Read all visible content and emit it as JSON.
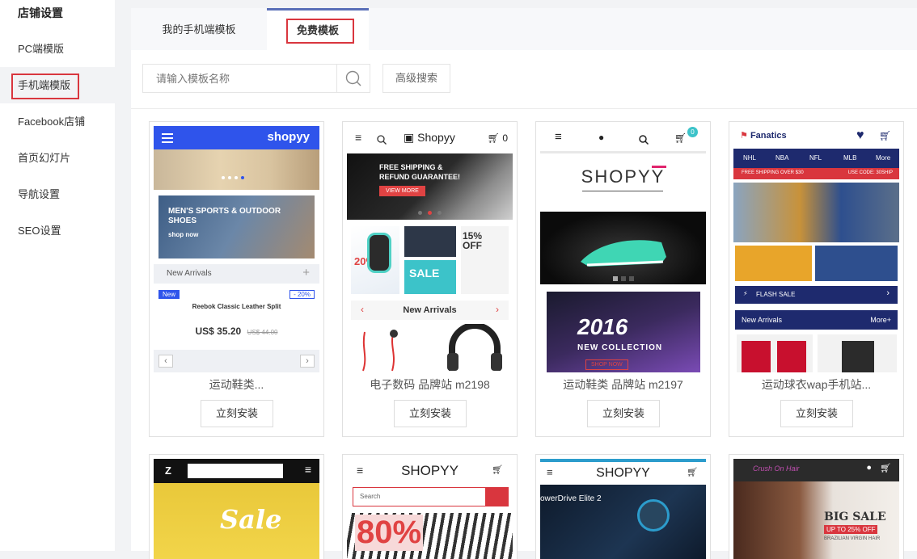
{
  "sidebar": {
    "title": "店铺设置",
    "items": [
      "PC端模版",
      "手机端模版",
      "Facebook店铺",
      "首页幻灯片",
      "导航设置",
      "SEO设置"
    ]
  },
  "tabs": [
    "我的手机端模板",
    "免费模板"
  ],
  "search": {
    "placeholder": "请输入模板名称",
    "advanced_label": "高级搜索"
  },
  "install_label": "立刻安装",
  "templates": [
    {
      "name": "运动鞋类...",
      "brand": "shopyy",
      "banner_text": "MEN'S SPORTS & OUTDOOR SHOES",
      "banner_link": "shop now",
      "section": "New Arrivals",
      "badge_new": "New",
      "badge_discount": "- 20%",
      "product": "Reebok Classic Leather Split",
      "price": "US$ 35.20",
      "old_price": "US$ 44.00"
    },
    {
      "name": "电子数码 品牌站 m2198",
      "brand": "Shopyy",
      "cart_count": "0",
      "hero_line1": "FREE SHIPPING &",
      "hero_line2": "REFUND GUARANTEE!",
      "hero_btn": "VIEW MORE",
      "promo1": "20%",
      "promo2": "SALE",
      "promo3": "15% OFF",
      "section": "New Arrivals"
    },
    {
      "name": "运动鞋类 品牌站 m2197",
      "brand": "SHOPYY",
      "cart_count": "0",
      "hero_year": "2016",
      "hero_sub": "NEW COLLECTION",
      "hero_btn": "SHOP NOW"
    },
    {
      "name": "运动球衣wap手机站...",
      "brand": "Fanatics",
      "nav": [
        "NHL",
        "NBA",
        "NFL",
        "MLB",
        "More"
      ],
      "promo_left": "FREE SHIPPING OVER $30",
      "promo_right": "USE CODE: 30SHIP",
      "flash": "FLASH SALE",
      "section": "New Arrivals",
      "more": "More+"
    }
  ],
  "templates_row2": [
    {
      "logo": "Z",
      "sale": "Sale"
    },
    {
      "brand": "SHOPYY",
      "search_placeholder": "Search",
      "promo": "80%"
    },
    {
      "brand": "SHOPYY",
      "product": "owerDrive Elite 2"
    },
    {
      "brand": "Crush On Hair",
      "promo1": "BIG SALE",
      "promo2": "UP TO 25% OFF",
      "promo3": "BRAZILIAN VIRGIN HAIR"
    }
  ],
  "colors": {
    "accent_red": "#d9363e",
    "tab_blue": "#5a6fb8",
    "shopyy_blue": "#2f54eb",
    "fanatics_navy": "#1e2a6e"
  }
}
